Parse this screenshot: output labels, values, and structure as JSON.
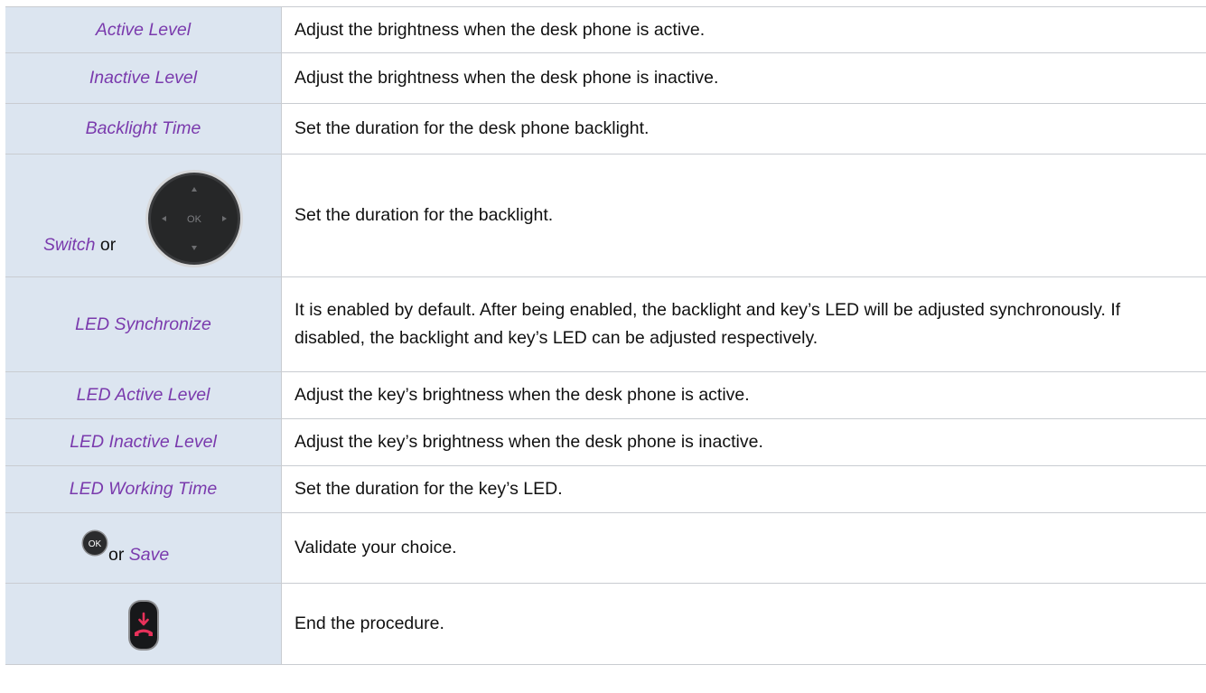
{
  "rows": [
    {
      "key": "Active Level",
      "desc": "Adjust the brightness when the desk phone is active."
    },
    {
      "key": "Inactive Level",
      "desc": "Adjust the brightness when the desk phone is inactive."
    },
    {
      "key": "Backlight Time",
      "desc": "Set the duration for the desk phone backlight."
    },
    {
      "key": "Switch",
      "key_suffix": "or",
      "icon": "navigator-pad-icon",
      "icon_label": "OK",
      "desc": "Set the duration for the backlight."
    },
    {
      "key": "LED Synchronize",
      "desc": "It is enabled by default. After being enabled, the backlight and key’s LED will be adjusted synchronously. If disabled, the backlight and key’s LED can be adjusted respectively."
    },
    {
      "key": "LED Active Level",
      "desc": "Adjust the key’s brightness when the desk phone is active."
    },
    {
      "key": "LED Inactive Level",
      "desc": "Adjust the key’s brightness when the desk phone is inactive."
    },
    {
      "key": "LED Working Time",
      "desc": "Set the duration for the key’s LED."
    },
    {
      "key_prefix": "or",
      "key": "Save",
      "icon": "ok-key-icon",
      "icon_label": "OK",
      "desc": "Validate your choice."
    },
    {
      "icon": "hang-up-key-icon",
      "desc": "End the procedure."
    }
  ],
  "colors": {
    "keyword": "#7a3aad",
    "key_cell_bg": "#dce5f0",
    "hangup_red": "#e8315a"
  }
}
